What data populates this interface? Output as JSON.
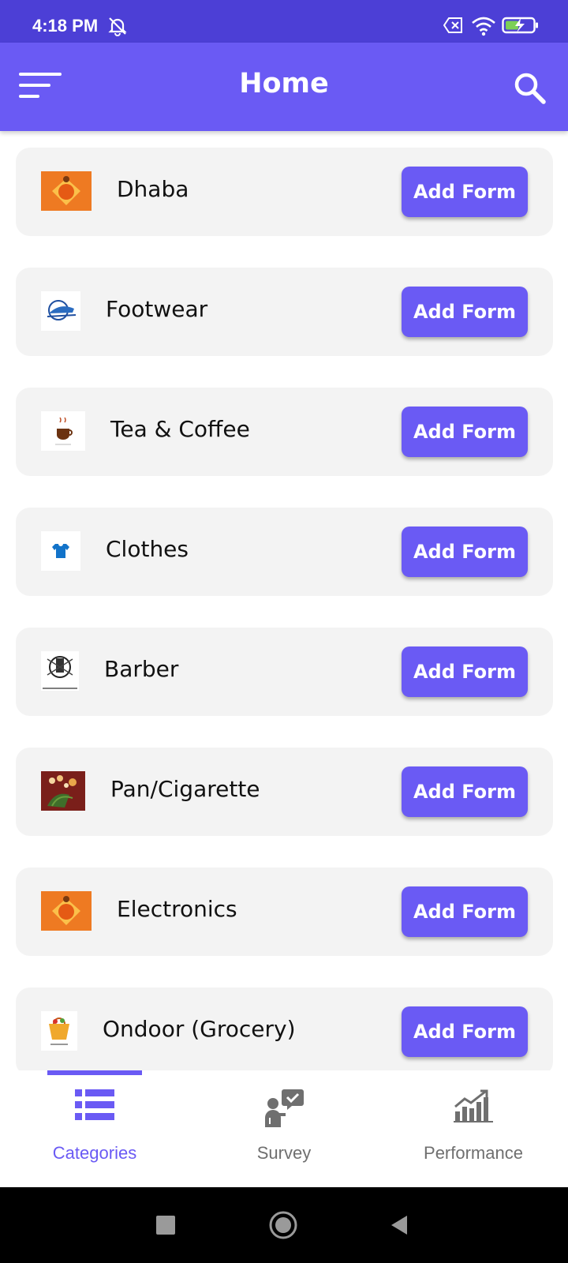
{
  "status_bar": {
    "time": "4:18 PM",
    "icons": [
      "bell-muted-icon",
      "close-box-icon",
      "wifi-icon",
      "battery-charging-icon"
    ]
  },
  "app_bar": {
    "title": "Home",
    "menu_icon": "menu-icon",
    "search_icon": "search-icon"
  },
  "categories": [
    {
      "label": "Dhaba",
      "thumb": "dhaba-logo"
    },
    {
      "label": "Footwear",
      "thumb": "footwear-logo"
    },
    {
      "label": "Tea & Coffee",
      "thumb": "tea-coffee-logo"
    },
    {
      "label": "Clothes",
      "thumb": "clothes-logo"
    },
    {
      "label": "Barber",
      "thumb": "barber-logo"
    },
    {
      "label": "Pan/Cigarette",
      "thumb": "pan-cigarette-logo"
    },
    {
      "label": "Electronics",
      "thumb": "electronics-logo"
    },
    {
      "label": "Ondoor (Grocery)",
      "thumb": "grocery-logo"
    }
  ],
  "add_form_label": "Add Form",
  "bottom_nav": {
    "items": [
      {
        "label": "Categories",
        "icon": "list-icon",
        "active": true
      },
      {
        "label": "Survey",
        "icon": "survey-icon",
        "active": false
      },
      {
        "label": "Performance",
        "icon": "performance-chart-icon",
        "active": false
      }
    ]
  },
  "colors": {
    "status_bar": "#4c3fd6",
    "primary": "#6a5af4",
    "card_bg": "#f3f3f3",
    "nav_inactive": "#6f6f6f"
  }
}
